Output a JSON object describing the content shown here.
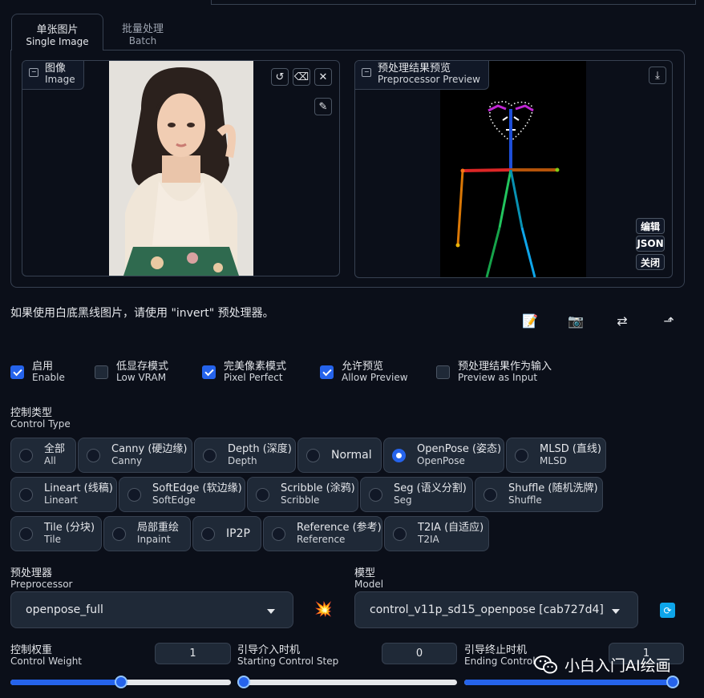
{
  "tabs": [
    {
      "zh": "单张图片",
      "en": "Single Image"
    },
    {
      "zh": "批量处理",
      "en": "Batch"
    }
  ],
  "image_panel": {
    "zh": "图像",
    "en": "Image"
  },
  "preview_panel": {
    "zh": "预处理结果预览",
    "en": "Preprocessor Preview"
  },
  "preview_buttons": {
    "edit": "编辑",
    "json": "JSON",
    "close": "关闭"
  },
  "note": "如果使用白底黑线图片，请使用 \"invert\" 预处理器。",
  "toggles": [
    {
      "zh": "启用",
      "en": "Enable",
      "checked": true
    },
    {
      "zh": "低显存模式",
      "en": "Low VRAM",
      "checked": false
    },
    {
      "zh": "完美像素模式",
      "en": "Pixel Perfect",
      "checked": true
    },
    {
      "zh": "允许预览",
      "en": "Allow Preview",
      "checked": true
    },
    {
      "zh": "预处理结果作为输入",
      "en": "Preview as Input",
      "checked": false
    }
  ],
  "control_type": {
    "label_zh": "控制类型",
    "label_en": "Control Type",
    "selected": "OpenPose",
    "options": [
      {
        "zh": "全部",
        "en": "All"
      },
      {
        "zh": "Canny (硬边缘)",
        "en": "Canny"
      },
      {
        "zh": "Depth (深度)",
        "en": "Depth"
      },
      {
        "zh": "Normal",
        "en": ""
      },
      {
        "zh": "OpenPose (姿态)",
        "en": "OpenPose"
      },
      {
        "zh": "MLSD (直线)",
        "en": "MLSD"
      },
      {
        "zh": "Lineart (线稿)",
        "en": "Lineart"
      },
      {
        "zh": "SoftEdge (软边缘)",
        "en": "SoftEdge"
      },
      {
        "zh": "Scribble (涂鸦)",
        "en": "Scribble"
      },
      {
        "zh": "Seg (语义分割)",
        "en": "Seg"
      },
      {
        "zh": "Shuffle (随机洗牌)",
        "en": "Shuffle"
      },
      {
        "zh": "Tile (分块)",
        "en": "Tile"
      },
      {
        "zh": "局部重绘",
        "en": "Inpaint"
      },
      {
        "zh": "IP2P",
        "en": ""
      },
      {
        "zh": "Reference (参考)",
        "en": "Reference"
      },
      {
        "zh": "T2IA (自适应)",
        "en": "T2IA"
      }
    ]
  },
  "preprocessor": {
    "label_zh": "预处理器",
    "label_en": "Preprocessor",
    "value": "openpose_full"
  },
  "model": {
    "label_zh": "模型",
    "label_en": "Model",
    "value": "control_v11p_sd15_openpose [cab727d4]"
  },
  "sliders": [
    {
      "zh": "控制权重",
      "en": "Control Weight",
      "value": "1",
      "fraction": 0.5
    },
    {
      "zh": "引导介入时机",
      "en": "Starting Control Step",
      "value": "0",
      "fraction": 0.0
    },
    {
      "zh": "引导终止时机",
      "en": "Ending Control",
      "value": "1",
      "fraction": 1.0
    }
  ],
  "watermark": "小白入门AI绘画"
}
